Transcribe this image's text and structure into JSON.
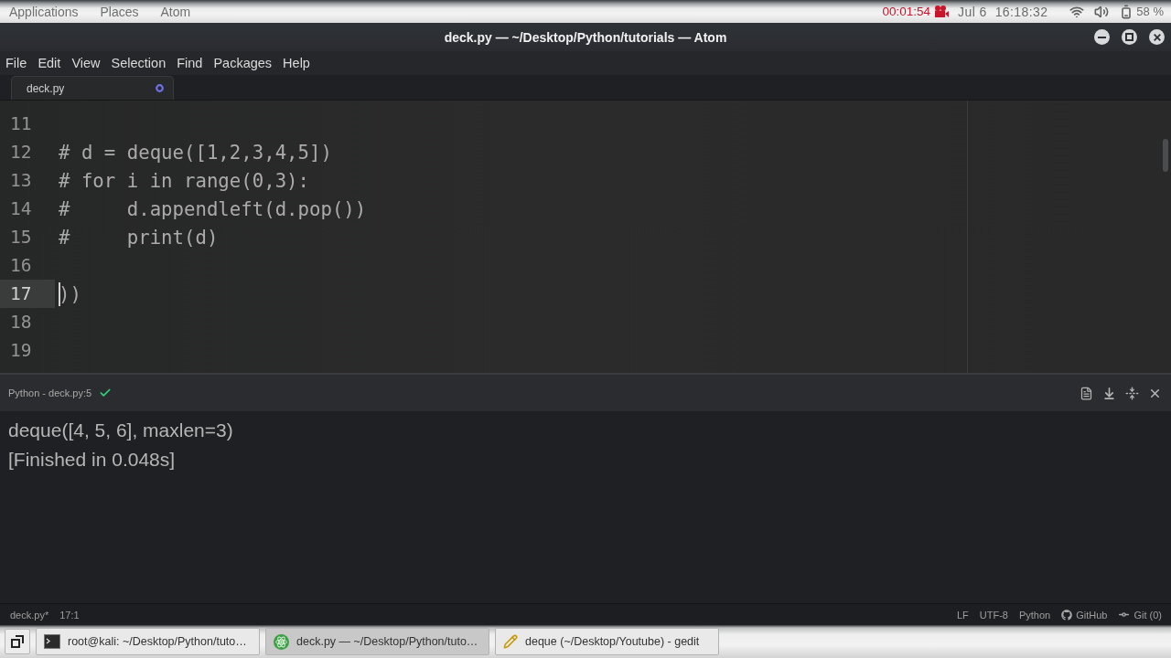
{
  "top_bar": {
    "menus": [
      "Applications",
      "Places",
      "Atom"
    ],
    "recording": {
      "elapsed": "00:01:54"
    },
    "date": "Jul 6",
    "time": "16:18:32",
    "battery": "58 %"
  },
  "window": {
    "title": "deck.py — ~/Desktop/Python/tutorials — Atom"
  },
  "menu_bar": [
    "File",
    "Edit",
    "View",
    "Selection",
    "Find",
    "Packages",
    "Help"
  ],
  "tabs": [
    {
      "label": "deck.py",
      "selected": true,
      "modified": true
    }
  ],
  "editor": {
    "lines": [
      {
        "number": "11",
        "cursor": false
      },
      {
        "number": "12",
        "code": "# d = deque([1,2,3,4,5])",
        "cursor": false
      },
      {
        "number": "13",
        "code": "# for i in range(0,3):",
        "cursor": false
      },
      {
        "number": "14",
        "code": "#     d.appendleft(d.pop())",
        "cursor": false
      },
      {
        "number": "15",
        "code": "#     print(d)",
        "cursor": false
      },
      {
        "number": "16",
        "cursor": false
      },
      {
        "number": "17",
        "code": "))",
        "cursor": true
      },
      {
        "number": "18",
        "cursor": false
      },
      {
        "number": "19",
        "cursor": false
      }
    ]
  },
  "output_panel": {
    "title": "Python - deck.py:5",
    "succeeded": true,
    "lines": [
      "deque([4, 5, 6], maxlen=3)",
      "[Finished in 0.048s]"
    ]
  },
  "status_bar": {
    "file": "deck.py*",
    "cursor_position": "17:1",
    "line_ending": "LF",
    "encoding": "UTF-8",
    "grammar": "Python",
    "github": "GitHub",
    "git": "Git (0)"
  },
  "taskbar": {
    "tasks": [
      {
        "kind": "terminal",
        "label": "root@kali: ~/Desktop/Python/tuto…",
        "selected": false
      },
      {
        "kind": "atom",
        "label": "deck.py — ~/Desktop/Python/tuto…",
        "selected": true
      },
      {
        "kind": "gedit",
        "label": "deque (~/Desktop/Youtube) - gedit",
        "selected": false
      }
    ]
  }
}
